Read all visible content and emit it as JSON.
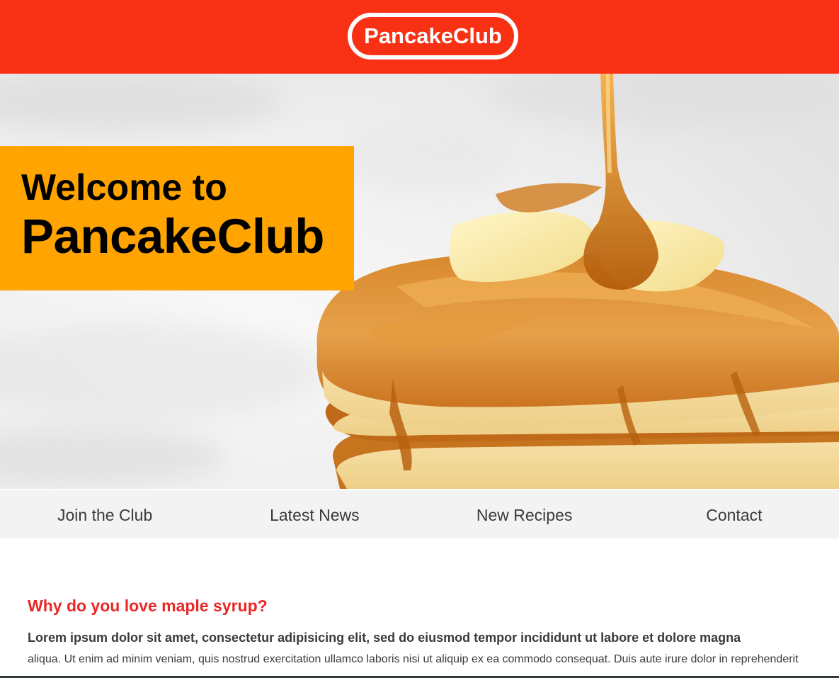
{
  "header": {
    "logo_text": "PancakeClub",
    "background_color": "#f83114"
  },
  "hero": {
    "image_subject": "stack-of-pancakes-with-butter-and-maple-syrup",
    "welcome_line1": "Welcome to",
    "welcome_line2": "PancakeClub",
    "welcome_box_color": "#ffa400"
  },
  "nav": {
    "items": [
      {
        "label": "Join the Club"
      },
      {
        "label": "Latest News"
      },
      {
        "label": "New Recipes"
      },
      {
        "label": "Contact"
      }
    ],
    "background_color": "#f3f3f3"
  },
  "article": {
    "heading": "Why do you love maple syrup?",
    "heading_color": "#e92727",
    "lead": "Lorem ipsum dolor sit amet, consectetur adipisicing elit, sed do eiusmod tempor incididunt ut labore et dolore magna",
    "body": "aliqua. Ut enim ad minim veniam, quis nostrud exercitation ullamco laboris nisi ut aliquip ex ea commodo consequat. Duis aute irure dolor in reprehenderit"
  }
}
